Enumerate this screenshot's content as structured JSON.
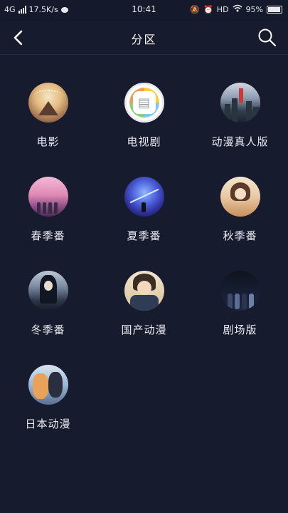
{
  "status_bar": {
    "network": "4G",
    "speed": "17.5K/s",
    "time": "10:41",
    "hd": "HD",
    "battery": "95%"
  },
  "header": {
    "title": "分区"
  },
  "categories": [
    {
      "label": "电影",
      "icon": "movie-thumbnail"
    },
    {
      "label": "电视剧",
      "icon": "tv-series-thumbnail"
    },
    {
      "label": "动漫真人版",
      "icon": "live-action-thumbnail"
    },
    {
      "label": "春季番",
      "icon": "spring-season-thumbnail"
    },
    {
      "label": "夏季番",
      "icon": "summer-season-thumbnail"
    },
    {
      "label": "秋季番",
      "icon": "autumn-season-thumbnail"
    },
    {
      "label": "冬季番",
      "icon": "winter-season-thumbnail"
    },
    {
      "label": "国产动漫",
      "icon": "domestic-anime-thumbnail"
    },
    {
      "label": "剧场版",
      "icon": "theatrical-thumbnail"
    },
    {
      "label": "日本动漫",
      "icon": "japanese-anime-thumbnail"
    }
  ],
  "colors": {
    "background": "#161b2e",
    "text": "#e8eaf0"
  }
}
